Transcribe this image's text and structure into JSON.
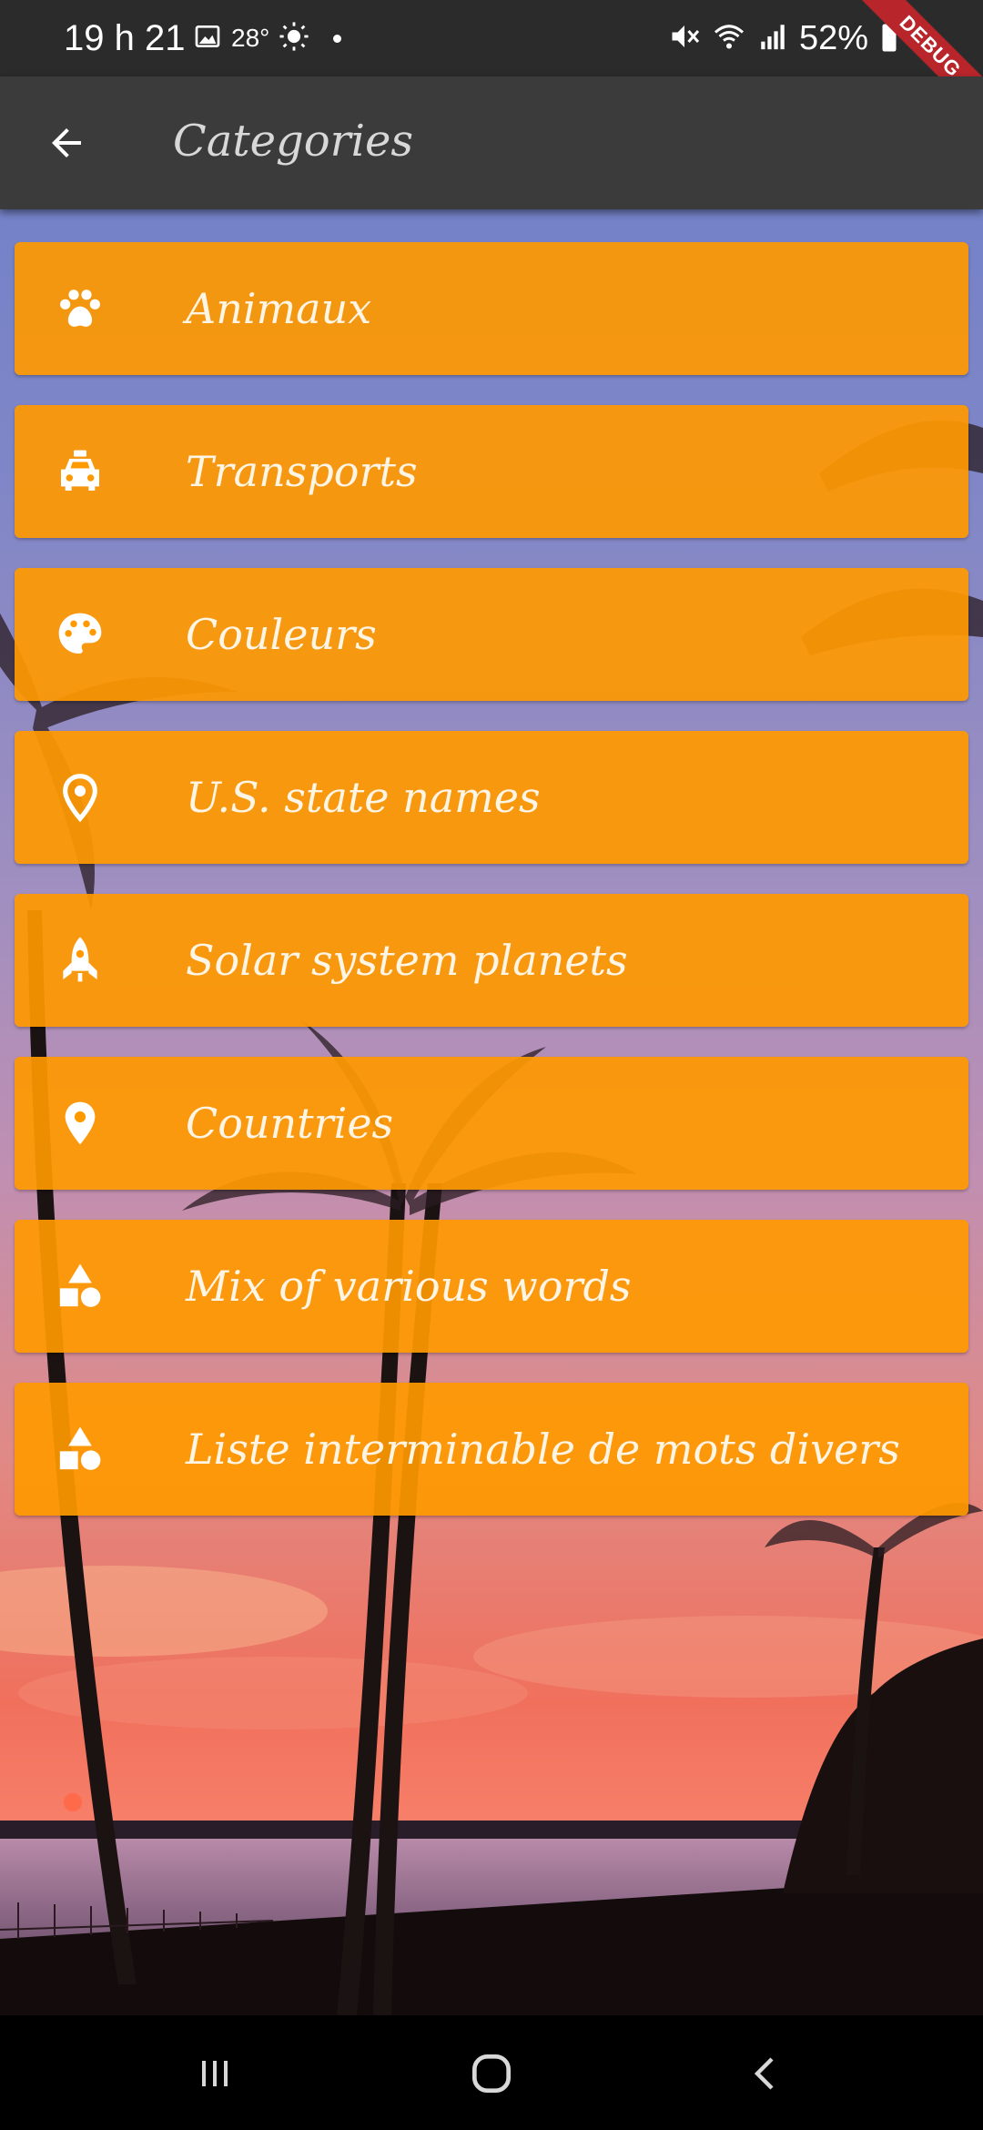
{
  "status_bar": {
    "time": "19 h 21",
    "temperature": "28°",
    "battery": "52%",
    "icons": [
      "image-icon",
      "weather-sun-icon",
      "mute-icon",
      "wifi-icon",
      "signal-icon",
      "battery-icon"
    ]
  },
  "debug_banner": "DEBUG",
  "appbar": {
    "title": "Categories",
    "back_icon": "arrow-left-icon"
  },
  "categories": [
    {
      "label": "Animaux",
      "icon": "paw-icon"
    },
    {
      "label": "Transports",
      "icon": "taxi-icon"
    },
    {
      "label": "Couleurs",
      "icon": "palette-icon"
    },
    {
      "label": "U.S. state names",
      "icon": "location-pin-outline-icon"
    },
    {
      "label": "Solar system planets",
      "icon": "rocket-icon"
    },
    {
      "label": "Countries",
      "icon": "location-pin-icon"
    },
    {
      "label": "Mix of various words",
      "icon": "shapes-icon"
    },
    {
      "label": "Liste interminable de mots divers",
      "icon": "shapes-icon"
    }
  ],
  "colors": {
    "item_background": "#ff9900",
    "appbar_background": "#3b3b3b",
    "status_bar_background": "#2b2b2b",
    "label_text": "#fff5e5"
  },
  "nav_bar": {
    "icons": [
      "recent-apps-icon",
      "home-icon",
      "back-icon"
    ]
  }
}
